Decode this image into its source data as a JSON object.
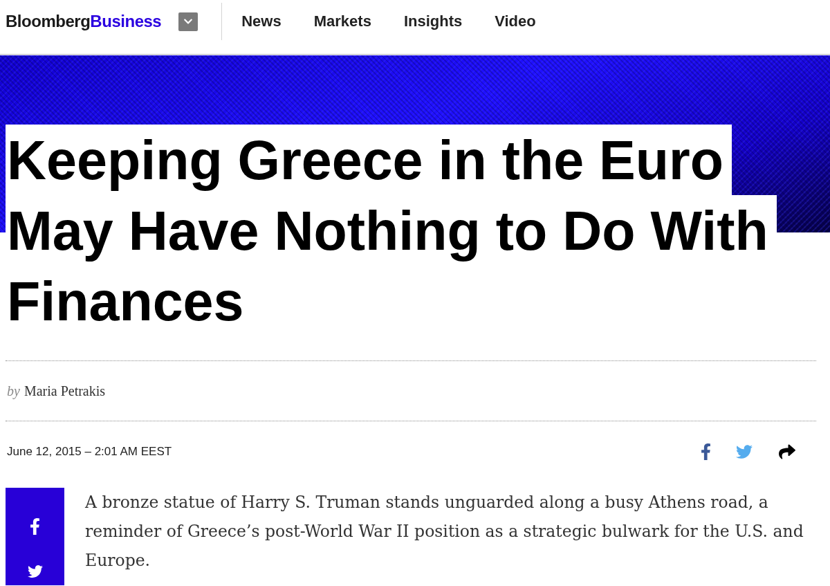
{
  "nav": {
    "logo": {
      "text": "Bloomberg",
      "accent": "Business"
    },
    "links": [
      {
        "label": "News"
      },
      {
        "label": "Markets"
      },
      {
        "label": "Insights"
      },
      {
        "label": "Video"
      }
    ]
  },
  "headline": "Keeping Greece in the Euro May Have Nothing to Do With Finances",
  "byline": {
    "prefix": "by",
    "author": "Maria Petrakis"
  },
  "timestamp": "June 12, 2015 – 2:01 AM EEST",
  "share_icons": [
    {
      "kind": "facebook"
    },
    {
      "kind": "twitter"
    },
    {
      "kind": "share"
    }
  ],
  "sidebar_share": [
    {
      "kind": "facebook"
    },
    {
      "kind": "twitter"
    }
  ],
  "article": {
    "paragraphs": [
      "A bronze statue of Harry S. Truman stands unguarded along a busy Athens road, a reminder of Greece’s post-World War II position as a strategic bulwark for the U.S. and Europe."
    ]
  }
}
